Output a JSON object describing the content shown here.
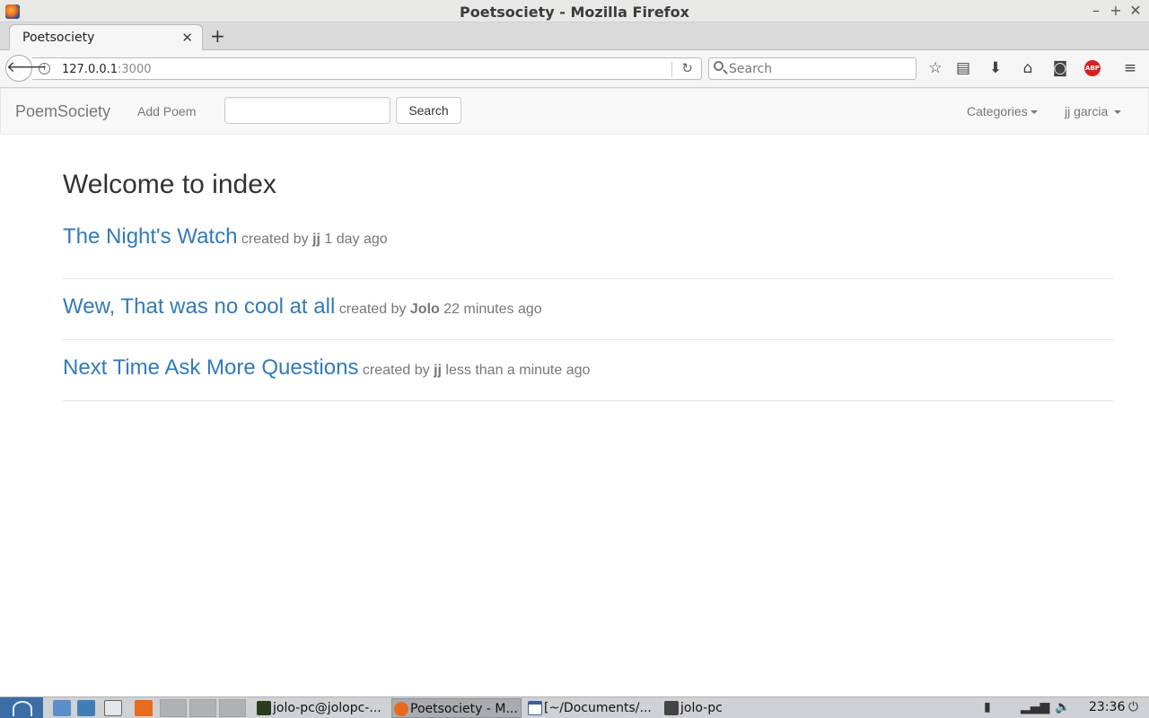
{
  "window": {
    "title": "Poetsociety - Mozilla Firefox"
  },
  "tabs": [
    {
      "label": "Poetsociety"
    }
  ],
  "browser": {
    "url_host": "127.0.0.1",
    "url_port": ":3000",
    "search_placeholder": "Search",
    "abp_label": "ABP"
  },
  "site": {
    "brand": "PoemSociety",
    "nav": {
      "add_poem": "Add Poem",
      "search_button": "Search",
      "categories": "Categories",
      "user": "jj garcia"
    },
    "heading": "Welcome to index",
    "poems": [
      {
        "title": "The Night's Watch",
        "created_by": "created by",
        "author": "jj",
        "time": "1 day ago"
      },
      {
        "title": "Wew, That was no cool at all",
        "created_by": "created by",
        "author": "Jolo",
        "time": "22 minutes ago"
      },
      {
        "title": "Next Time Ask More Questions",
        "created_by": "created by",
        "author": "jj",
        "time": "less than a minute ago"
      }
    ]
  },
  "taskbar": {
    "tasks": [
      {
        "label": "jolo-pc@jolopc-..."
      },
      {
        "label": "Poetsociety - M..."
      },
      {
        "label": "[~/Documents/..."
      },
      {
        "label": "jolo-pc"
      }
    ],
    "clock": "23:36"
  },
  "colors": {
    "link": "#337ab7",
    "muted": "#777777",
    "abp": "#d81e1e"
  }
}
